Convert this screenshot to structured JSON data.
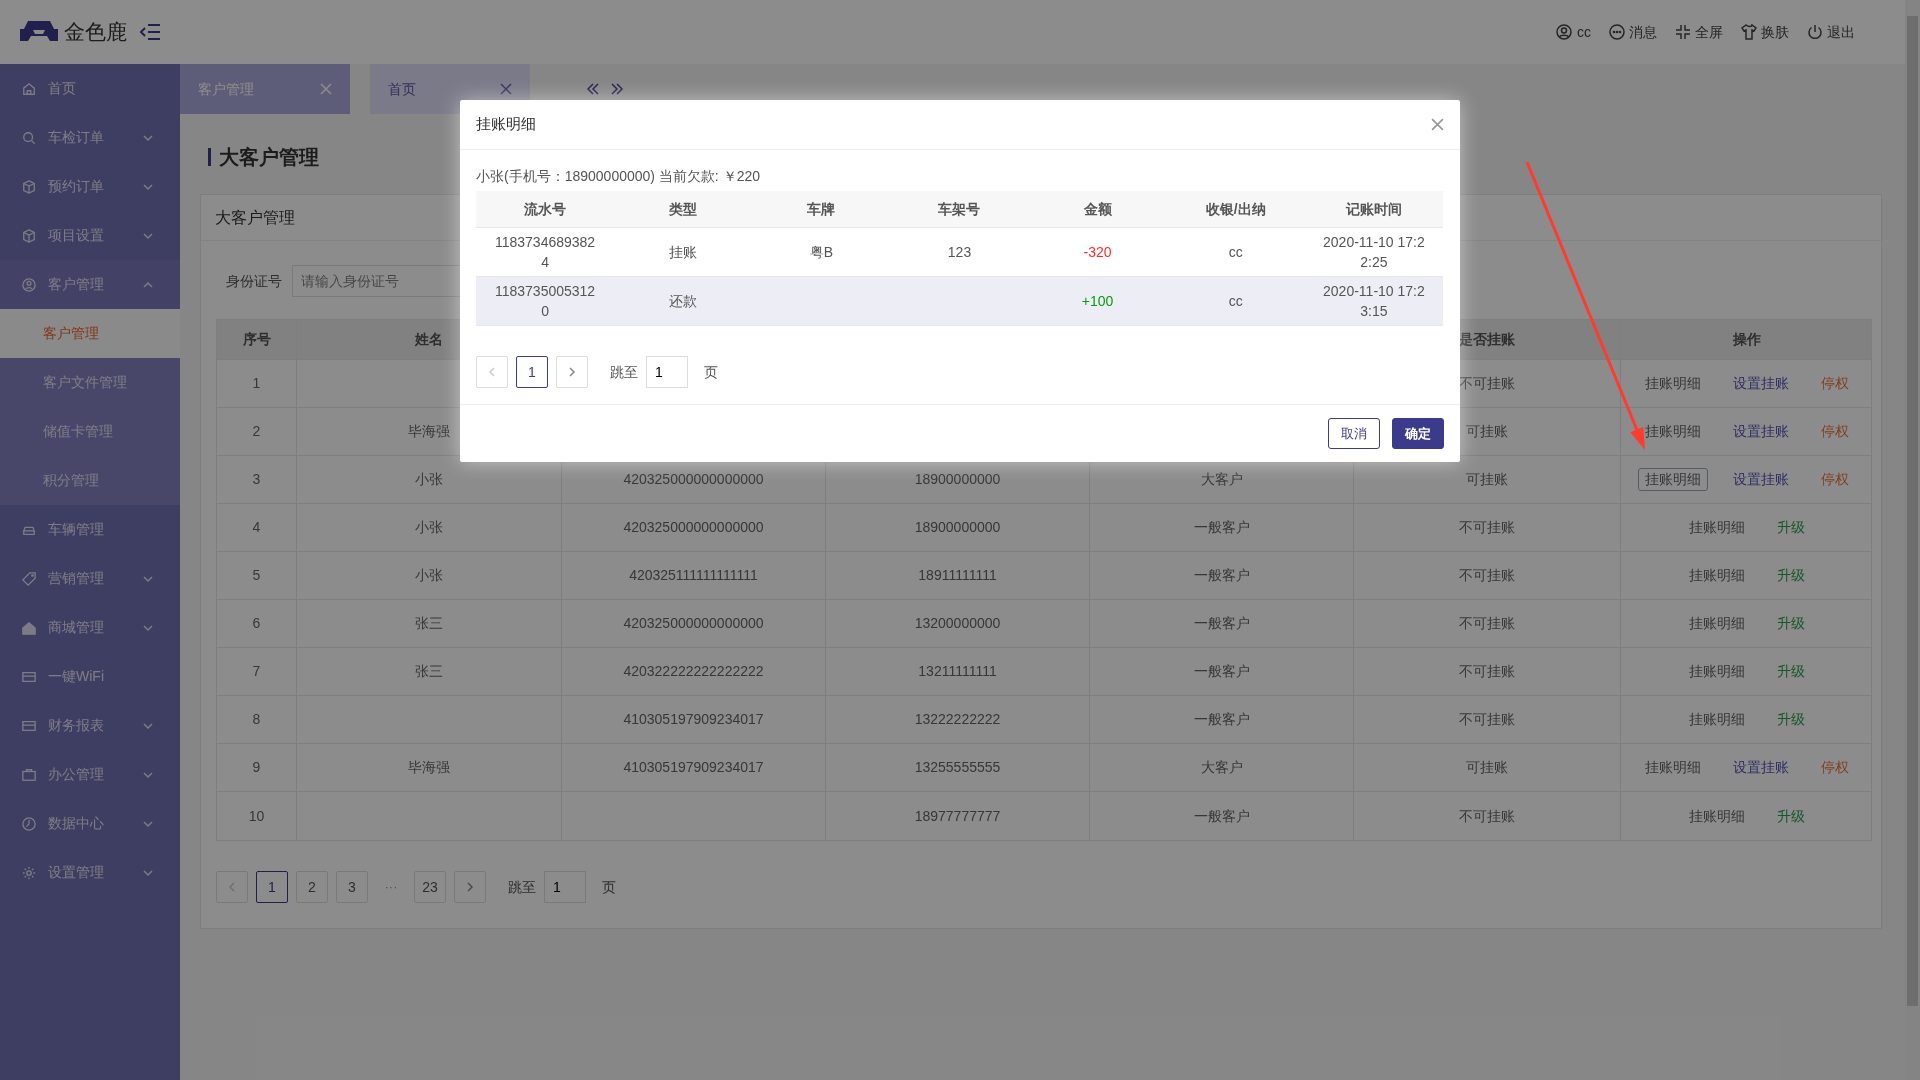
{
  "header": {
    "logo": "金色鹿",
    "user": "cc",
    "actions": [
      {
        "label": "消息"
      },
      {
        "label": "全屏"
      },
      {
        "label": "换肤"
      },
      {
        "label": "退出"
      }
    ]
  },
  "sidebar": {
    "items": [
      {
        "label": "首页",
        "expandable": false
      },
      {
        "label": "车检订单",
        "expandable": true,
        "expanded": false
      },
      {
        "label": "预约订单",
        "expandable": true,
        "expanded": false
      },
      {
        "label": "项目设置",
        "expandable": true,
        "expanded": false
      },
      {
        "label": "客户管理",
        "expandable": true,
        "expanded": true,
        "children": [
          {
            "label": "客户管理",
            "selected": true
          },
          {
            "label": "客户文件管理",
            "selected": false
          },
          {
            "label": "储值卡管理",
            "selected": false
          },
          {
            "label": "积分管理",
            "selected": false
          }
        ]
      },
      {
        "label": "车辆管理",
        "expandable": false
      },
      {
        "label": "营销管理",
        "expandable": true,
        "expanded": false
      },
      {
        "label": "商城管理",
        "expandable": true,
        "expanded": false
      },
      {
        "label": "一键WiFi",
        "expandable": false
      },
      {
        "label": "财务报表",
        "expandable": true,
        "expanded": false
      },
      {
        "label": "办公管理",
        "expandable": true,
        "expanded": false
      },
      {
        "label": "数据中心",
        "expandable": true,
        "expanded": false
      },
      {
        "label": "设置管理",
        "expandable": true,
        "expanded": false
      }
    ]
  },
  "tabs": [
    {
      "label": "客户管理",
      "selected": true
    },
    {
      "label": "首页",
      "selected": false
    }
  ],
  "page": {
    "title": "大客户管理",
    "card_title": "大客户管理",
    "search": {
      "label": "身份证号",
      "placeholder": "请输入身份证号"
    }
  },
  "table": {
    "headers": {
      "index": "序号",
      "name": "姓名",
      "credit": "是否挂账",
      "actions": "操作"
    },
    "rows": [
      {
        "index": "1",
        "credit": "不可挂账",
        "actions": [
          {
            "label": "挂账明细",
            "kind": "detail",
            "focused": false
          },
          {
            "label": "设置挂账",
            "kind": "set",
            "focused": false
          },
          {
            "label": "停权",
            "kind": "suspend",
            "focused": false
          }
        ]
      },
      {
        "index": "2",
        "name": "毕海强",
        "credit": "可挂账",
        "actions": [
          {
            "label": "挂账明细",
            "kind": "detail",
            "focused": false
          },
          {
            "label": "设置挂账",
            "kind": "set",
            "focused": false
          },
          {
            "label": "停权",
            "kind": "suspend",
            "focused": false
          }
        ]
      },
      {
        "index": "3",
        "name": "小张",
        "column_3": "420325000000000000",
        "column_4": "18900000000",
        "column_5": "大客户",
        "credit": "可挂账",
        "actions": [
          {
            "label": "挂账明细",
            "kind": "detail",
            "focused": true
          },
          {
            "label": "设置挂账",
            "kind": "set",
            "focused": false
          },
          {
            "label": "停权",
            "kind": "suspend",
            "focused": false
          }
        ]
      },
      {
        "index": "4",
        "name": "小张",
        "column_3": "420325000000000000",
        "column_4": "18900000000",
        "column_5": "一般客户",
        "credit": "不可挂账",
        "actions": [
          {
            "label": "挂账明细",
            "kind": "detail",
            "focused": false
          },
          {
            "label": "升级",
            "kind": "upgrade",
            "focused": false
          }
        ]
      },
      {
        "index": "5",
        "name": "小张",
        "column_3": "420325111111111111",
        "column_4": "18911111111",
        "column_5": "一般客户",
        "credit": "不可挂账",
        "actions": [
          {
            "label": "挂账明细",
            "kind": "detail",
            "focused": false
          },
          {
            "label": "升级",
            "kind": "upgrade",
            "focused": false
          }
        ]
      },
      {
        "index": "6",
        "name": "张三",
        "column_3": "420325000000000000",
        "column_4": "13200000000",
        "column_5": "一般客户",
        "credit": "不可挂账",
        "actions": [
          {
            "label": "挂账明细",
            "kind": "detail",
            "focused": false
          },
          {
            "label": "升级",
            "kind": "upgrade",
            "focused": false
          }
        ]
      },
      {
        "index": "7",
        "name": "张三",
        "column_3": "420322222222222222",
        "column_4": "13211111111",
        "column_5": "一般客户",
        "credit": "不可挂账",
        "actions": [
          {
            "label": "挂账明细",
            "kind": "detail",
            "focused": false
          },
          {
            "label": "升级",
            "kind": "upgrade",
            "focused": false
          }
        ]
      },
      {
        "index": "8",
        "column_3": "410305197909234017",
        "column_4": "13222222222",
        "column_5": "一般客户",
        "credit": "不可挂账",
        "actions": [
          {
            "label": "挂账明细",
            "kind": "detail",
            "focused": false
          },
          {
            "label": "升级",
            "kind": "upgrade",
            "focused": false
          }
        ]
      },
      {
        "index": "9",
        "name": "毕海强",
        "column_3": "410305197909234017",
        "column_4": "13255555555",
        "column_5": "大客户",
        "credit": "可挂账",
        "actions": [
          {
            "label": "挂账明细",
            "kind": "detail",
            "focused": false
          },
          {
            "label": "设置挂账",
            "kind": "set",
            "focused": false
          },
          {
            "label": "停权",
            "kind": "suspend",
            "focused": false
          }
        ]
      },
      {
        "index": "10",
        "column_4": "18977777777",
        "column_5": "一般客户",
        "credit": "不可挂账",
        "actions": [
          {
            "label": "挂账明细",
            "kind": "detail",
            "focused": false
          },
          {
            "label": "升级",
            "kind": "upgrade",
            "focused": false
          }
        ]
      }
    ]
  },
  "pagination": {
    "pages": [
      {
        "label": "1",
        "selected": true
      },
      {
        "label": "2",
        "selected": false
      },
      {
        "label": "3",
        "selected": false
      },
      {
        "label": "···",
        "kind": "ellipsis"
      },
      {
        "label": "23",
        "selected": false
      }
    ],
    "jump_label": "跳至",
    "jump_value": "1",
    "suffix": "页"
  },
  "modal": {
    "title": "挂账明细",
    "info": "小张(手机号：18900000000) 当前欠款: ￥220",
    "columns": [
      "流水号",
      "类型",
      "车牌",
      "车架号",
      "金额",
      "收银/出纳",
      "记账时间"
    ],
    "rows": [
      {
        "serial": "11837346893824",
        "type": "挂账",
        "plate": "粤B",
        "frame": "123",
        "amount": "-320",
        "kind": "debit",
        "cashier": "cc",
        "time": "2020-11-10 17:22:25",
        "hovered": false
      },
      {
        "serial": "11837350053120",
        "type": "还款",
        "amount": "+100",
        "kind": "credit",
        "cashier": "cc",
        "time": "2020-11-10 17:23:15",
        "hovered": true
      }
    ],
    "pagination": {
      "pages": [
        {
          "label": "1",
          "selected": true
        }
      ],
      "jump_label": "跳至",
      "jump_value": "1",
      "suffix": "页"
    },
    "buttons": [
      {
        "label": "取消",
        "kind": "secondary"
      },
      {
        "label": "确定",
        "kind": "primary"
      }
    ]
  }
}
